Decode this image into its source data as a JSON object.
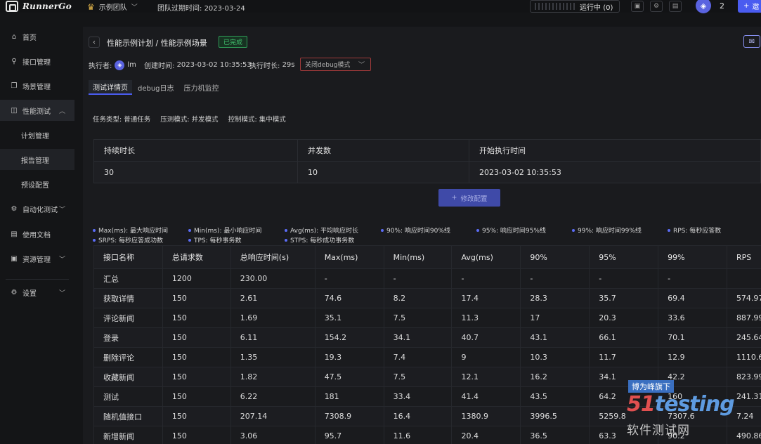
{
  "topbar": {
    "app_name": "RunnerGo",
    "team_name": "示例团队",
    "expire_label": "团队过期时间:",
    "expire_date": "2023-03-24",
    "running_label": "运行中",
    "running_count": "(0)",
    "user_count": "2",
    "invite_label": "邀"
  },
  "sidebar": {
    "items": [
      {
        "label": "首页",
        "icon": "home-icon"
      },
      {
        "label": "接口管理",
        "icon": "link-icon"
      },
      {
        "label": "场景管理",
        "icon": "scene-icon"
      },
      {
        "label": "性能测试",
        "icon": "chart-icon"
      },
      {
        "label": "计划管理"
      },
      {
        "label": "报告管理"
      },
      {
        "label": "预设配置"
      },
      {
        "label": "自动化测试",
        "icon": "auto-icon"
      },
      {
        "label": "使用文档",
        "icon": "doc-icon"
      },
      {
        "label": "资源管理",
        "icon": "resource-icon"
      },
      {
        "label": "设置",
        "icon": "gear-icon"
      }
    ]
  },
  "header": {
    "title": "性能示例计划 / 性能示例场景",
    "status": "已完成",
    "executor_label": "执行者:",
    "executor_name": "lm",
    "created_label": "创建时间:",
    "created_value": "2023-03-02 10:35:53",
    "duration_label": "执行时长:",
    "duration_value": "29s",
    "debug_select": "关闭debug模式"
  },
  "tabs": [
    "测试详情页",
    "debug日志",
    "压力机监控"
  ],
  "task_info": {
    "type": "任务类型: 普通任务",
    "mode": "压测模式: 并发模式",
    "control": "控制模式: 集中模式"
  },
  "summary": {
    "headers": [
      "持续时长",
      "并发数",
      "开始执行时间"
    ],
    "values": [
      "30",
      "10",
      "2023-03-02 10:35:53"
    ]
  },
  "edit_button": "修改配置",
  "legend": [
    "Max(ms): 最大响应时间",
    "Min(ms): 最小响应时间",
    "Avg(ms): 平均响应时长",
    "90%: 响应时间90%线",
    "95%: 响应时间95%线",
    "99%: 响应时间99%线",
    "RPS: 每秒应答数",
    "SRPS: 每秒应答成功数",
    "TPS: 每秒事务数",
    "STPS: 每秒成功事务数"
  ],
  "table": {
    "headers": [
      "接口名称",
      "总请求数",
      "总响应时间(s)",
      "Max(ms)",
      "Min(ms)",
      "Avg(ms)",
      "90%",
      "95%",
      "99%",
      "RPS"
    ],
    "rows": [
      [
        "汇总",
        "1200",
        "230.00",
        "-",
        "-",
        "-",
        "-",
        "-",
        "-",
        ""
      ],
      [
        "获取详情",
        "150",
        "2.61",
        "74.6",
        "8.2",
        "17.4",
        "28.3",
        "35.7",
        "69.4",
        "574.97"
      ],
      [
        "评论新闻",
        "150",
        "1.69",
        "35.1",
        "7.5",
        "11.3",
        "17",
        "20.3",
        "33.6",
        "887.99"
      ],
      [
        "登录",
        "150",
        "6.11",
        "154.2",
        "34.1",
        "40.7",
        "43.1",
        "66.1",
        "70.1",
        "245.64"
      ],
      [
        "删除评论",
        "150",
        "1.35",
        "19.3",
        "7.4",
        "9",
        "10.3",
        "11.7",
        "12.9",
        "1110.6"
      ],
      [
        "收藏新闻",
        "150",
        "1.82",
        "47.5",
        "7.5",
        "12.1",
        "16.2",
        "34.1",
        "42.2",
        "823.99"
      ],
      [
        "测试",
        "150",
        "6.22",
        "181",
        "33.4",
        "41.4",
        "43.5",
        "64.2",
        "160",
        "241.31"
      ],
      [
        "随机值接口",
        "150",
        "207.14",
        "7308.9",
        "16.4",
        "1380.9",
        "3996.5",
        "5259.8",
        "7307.6",
        "7.24"
      ],
      [
        "新增新闻",
        "150",
        "3.06",
        "95.7",
        "11.6",
        "20.4",
        "36.5",
        "63.3",
        "90.2",
        "490.86"
      ]
    ]
  },
  "watermark": {
    "tag": "博为峰旗下",
    "brand_num": "51",
    "brand_text": "testing",
    "sub": "软件测试网"
  }
}
